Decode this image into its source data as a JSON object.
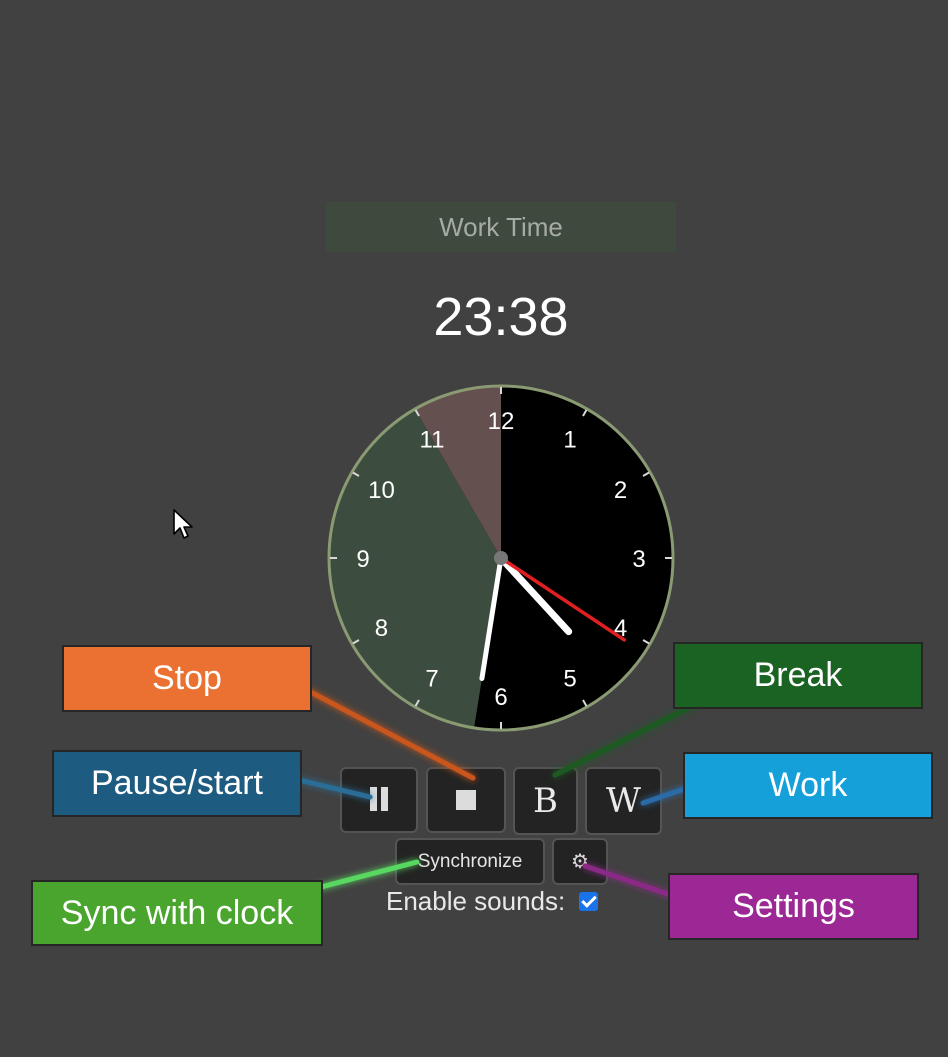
{
  "timer": {
    "mode_label": "Work Time",
    "time": "23:38"
  },
  "clock": {
    "numbers": [
      "12",
      "1",
      "2",
      "3",
      "4",
      "5",
      "6",
      "7",
      "8",
      "9",
      "10",
      "11"
    ],
    "hands": {
      "hour": 4.58,
      "minute": 31.5,
      "second": 20.6
    },
    "sectors": [
      {
        "kind": "work",
        "from_minute": 31.5,
        "to_minute": 55,
        "color": "#3c4c3e"
      },
      {
        "kind": "break",
        "from_minute": 55,
        "to_minute": 60,
        "color": "#655050"
      }
    ],
    "colors": {
      "face": "#000000",
      "rim": "#8a9a72",
      "hour_hand": "#ffffff",
      "minute_hand": "#ffffff",
      "second_hand": "#e02020",
      "center": "#777777"
    }
  },
  "controls": {
    "pause_icon": "pause-icon",
    "stop_icon": "stop-icon",
    "break_label": "B",
    "work_label": "W",
    "sync_label": "Synchronize",
    "settings_icon": "gear-icon",
    "sounds_label": "Enable sounds:",
    "sounds_enabled": true
  },
  "annotations": {
    "stop": "Stop",
    "pause": "Pause/start",
    "sync": "Sync with clock",
    "break": "Break",
    "work": "Work",
    "settings": "Settings"
  },
  "colors": {
    "background": "#414141",
    "stop_callout": "#ea7131",
    "pause_callout": "#1e5b80",
    "sync_callout": "#49a52e",
    "break_callout": "#1a6322",
    "work_callout": "#15a0da",
    "settings_callout": "#9b2895"
  }
}
